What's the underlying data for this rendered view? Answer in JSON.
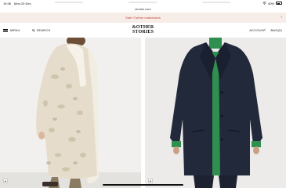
{
  "status_bar": {
    "time": "19:36",
    "date": "Mon 20 Dec",
    "battery": "40%",
    "icons": [
      "wifi-icon",
      "battery-icon"
    ]
  },
  "browser": {
    "url": "stories.com"
  },
  "promo": {
    "text": "Sale: Further markdowns",
    "icon": "chevron-right-icon"
  },
  "header": {
    "menu_label": "MENU",
    "search_label": "SEARCH",
    "logo_line1": "&OTHER",
    "logo_line2": "STORIES",
    "account_label": "ACCOUNT",
    "bag_label": "BAG(0)"
  },
  "products": [
    {
      "name": "cream-shaggy-coat-product",
      "add_icon": "+"
    },
    {
      "name": "navy-wool-coat-product",
      "add_icon": "+"
    }
  ],
  "colors": {
    "promo_bg": "#f6ece8",
    "promo_text": "#c9432f",
    "left_bg": "#f1f0ee",
    "right_bg": "#ecebe9"
  }
}
